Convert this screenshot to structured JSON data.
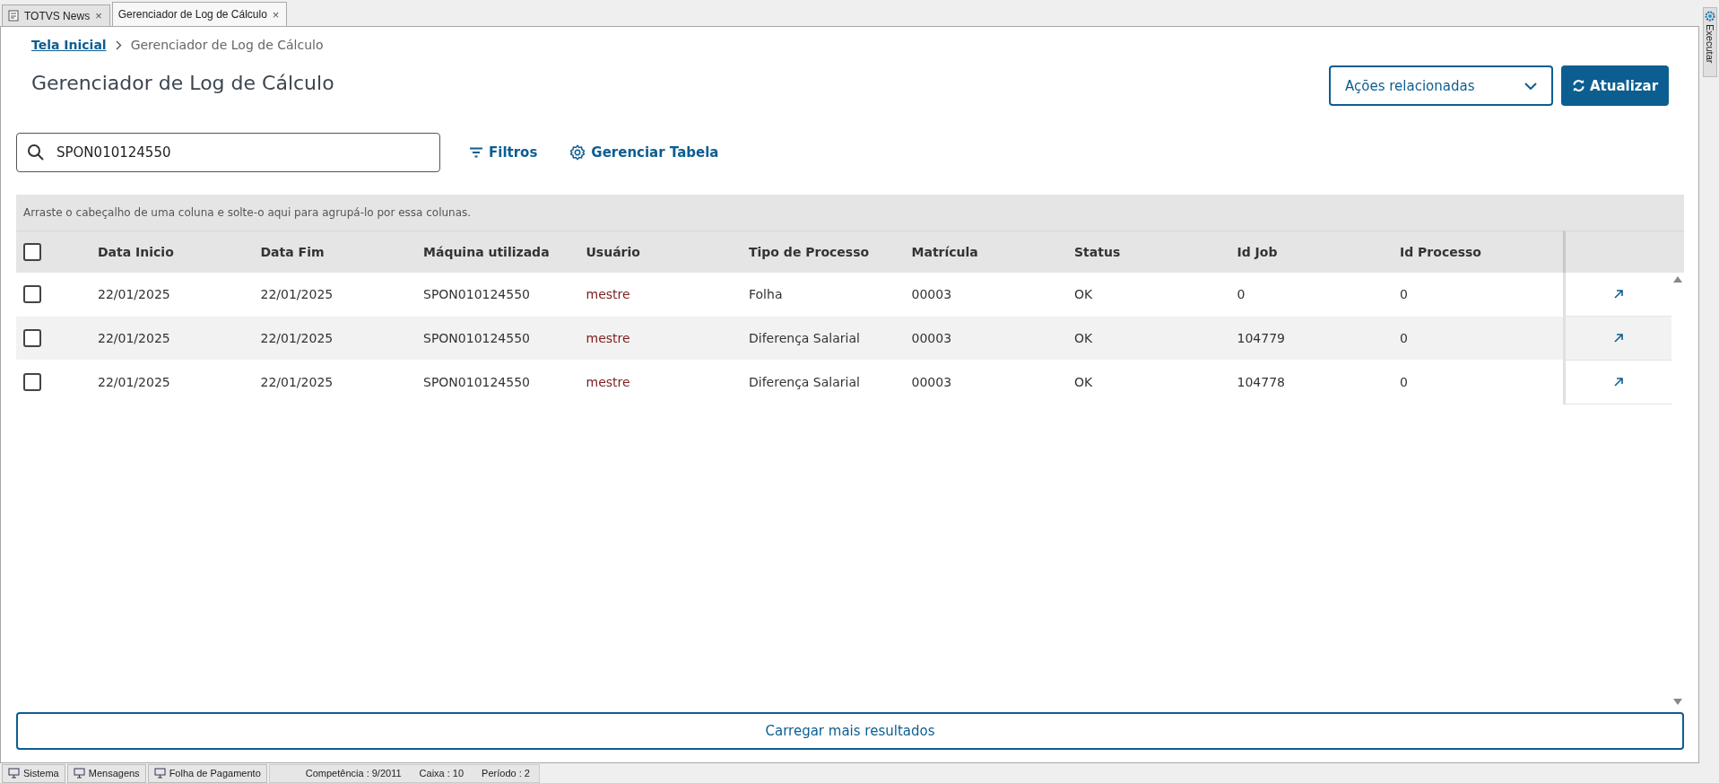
{
  "tabs": [
    {
      "label": "TOTVS News",
      "selected": false,
      "close": "×"
    },
    {
      "label": "Gerenciador de Log de Cálculo",
      "selected": true,
      "close": "×"
    }
  ],
  "side_panel": {
    "label": "Executar"
  },
  "breadcrumb": {
    "home": "Tela Inicial",
    "current": "Gerenciador de Log de Cálculo"
  },
  "page_title": "Gerenciador de Log de Cálculo",
  "actions": {
    "related": "Ações relacionadas",
    "refresh": "Atualizar"
  },
  "search": {
    "value": "SPON010124550"
  },
  "toolbar": [
    "Filtros",
    "Gerenciar Tabela"
  ],
  "group_hint": "Arraste o cabeçalho de uma coluna e solte-o aqui para agrupá-lo por essa colunas.",
  "table": {
    "all_checked": false,
    "columns": [
      "Data Inicio",
      "Data Fim",
      "Máquina utilizada",
      "Usuário",
      "Tipo de Processo",
      "Matrícula",
      "Status",
      "Id Job",
      "Id Processo"
    ],
    "rows": [
      {
        "checked": false,
        "cells": [
          "22/01/2025",
          "22/01/2025",
          "SPON010124550",
          "mestre",
          "Folha",
          "00003",
          "OK",
          "0",
          "0"
        ]
      },
      {
        "checked": false,
        "cells": [
          "22/01/2025",
          "22/01/2025",
          "SPON010124550",
          "mestre",
          "Diferença Salarial",
          "00003",
          "OK",
          "104779",
          "0"
        ]
      },
      {
        "checked": false,
        "cells": [
          "22/01/2025",
          "22/01/2025",
          "SPON010124550",
          "mestre",
          "Diferença Salarial",
          "00003",
          "OK",
          "104778",
          "0"
        ]
      }
    ]
  },
  "load_more": "Carregar mais resultados",
  "status_bar": {
    "buttons": [
      "Sistema",
      "Mensagens",
      "Folha de Pagamento"
    ],
    "fields": [
      "Competência : 9/2011",
      "Caixa : 10",
      "Período : 2"
    ]
  }
}
